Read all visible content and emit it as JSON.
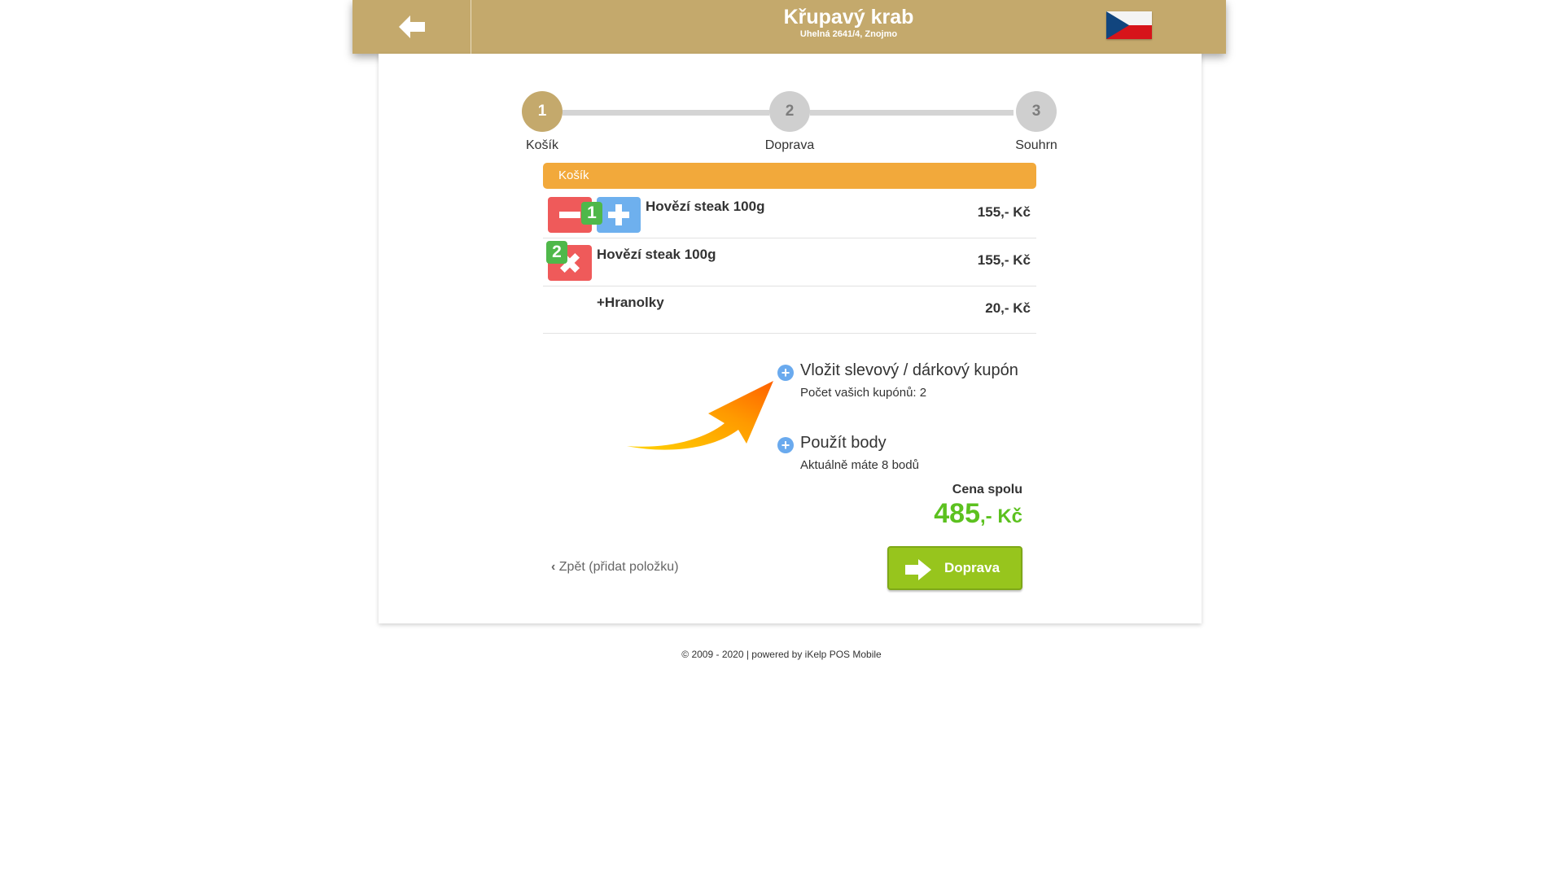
{
  "header": {
    "restaurant_name": "Křupavý krab",
    "address": "Uhelná 2641/4, Znojmo"
  },
  "stepper": {
    "steps": [
      {
        "number": "1",
        "label": "Košík"
      },
      {
        "number": "2",
        "label": "Doprava"
      },
      {
        "number": "3",
        "label": "Souhrn"
      }
    ]
  },
  "cart": {
    "title": "Košík",
    "items": [
      {
        "quantity": "1",
        "name": "Hovězí steak 100g",
        "price": "155,- Kč"
      },
      {
        "quantity": "2",
        "name": "Hovězí steak 100g",
        "price": "155,- Kč"
      },
      {
        "name": "+Hranolky",
        "price": "20,- Kč"
      }
    ]
  },
  "options": {
    "coupon_title": "Vložit slevový / dárkový kupón",
    "coupon_sub": "Počet vašich kupónů: 2",
    "points_title": "Použít body",
    "points_sub": "Aktuálně máte 8 bodů"
  },
  "total": {
    "label": "Cena spolu",
    "amount": "485",
    "currency": ",- Kč"
  },
  "actions": {
    "back_link": "Zpět (přidat položku)",
    "next_label": "Doprava"
  },
  "footer": {
    "text": "© 2009 - 2020 | powered by iKelp POS Mobile"
  },
  "colors": {
    "brand": "#c4a96c",
    "cart_header": "#f2a93b",
    "minus": "#ef5a5a",
    "plus": "#6eb0ee",
    "badge": "#4fb84a",
    "total": "#5cc11f",
    "next_button": "#97c51d"
  }
}
